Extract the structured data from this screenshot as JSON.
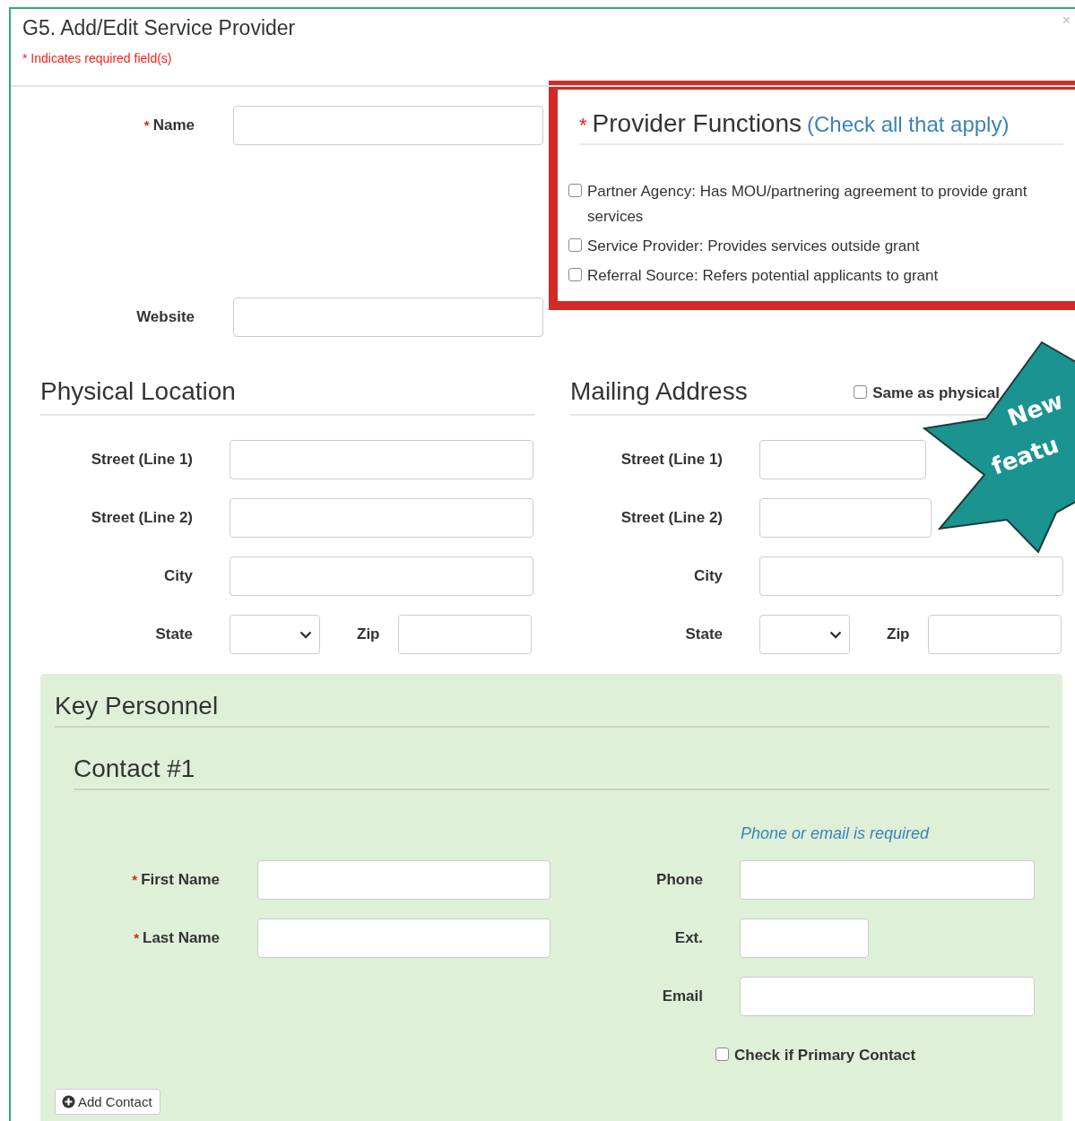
{
  "dialog": {
    "title": "G5. Add/Edit Service Provider",
    "close": "×",
    "required_note": "* Indicates required field(s)"
  },
  "fields": [
    {
      "label": "Name",
      "required_mark": "*"
    },
    {
      "label": "Website"
    }
  ],
  "provider_functions": {
    "required_mark": "*",
    "title": "Provider Functions",
    "hint": "(Check all that apply)",
    "options": [
      {
        "label": "Partner Agency: Has MOU/partnering agreement to provide grant services",
        "checked": false
      },
      {
        "label": "Service Provider: Provides services outside grant",
        "checked": false
      },
      {
        "label": "Referral Source: Refers potential applicants to grant",
        "checked": false
      }
    ]
  },
  "physical_location": {
    "title": "Physical Location",
    "fields": [
      {
        "kind": "text",
        "label": "Street (Line 1)"
      },
      {
        "kind": "text",
        "label": "Street (Line 2)"
      },
      {
        "kind": "text",
        "label": "City"
      },
      {
        "kind": "state_zip",
        "label": "State",
        "zip_label": "Zip"
      }
    ]
  },
  "mailing_address": {
    "title": "Mailing Address",
    "same_as": {
      "label": "Same as physical",
      "checked": false
    },
    "fields": [
      {
        "kind": "text",
        "label": "Street (Line 1)"
      },
      {
        "kind": "text",
        "label": "Street (Line 2)"
      },
      {
        "kind": "text",
        "label": "City"
      },
      {
        "kind": "state_zip",
        "label": "State",
        "zip_label": "Zip"
      }
    ]
  },
  "key_personnel": {
    "title": "Key Personnel",
    "contacts": [
      {
        "title": "Contact #1",
        "note": "Phone or email is required",
        "left_fields": [
          {
            "label": "First Name",
            "required_mark": "*"
          },
          {
            "label": "Last Name",
            "required_mark": "*"
          }
        ],
        "right_fields": [
          {
            "kind": "text",
            "label": "Phone"
          },
          {
            "kind": "short_text",
            "label": "Ext."
          },
          {
            "kind": "text",
            "label": "Email"
          }
        ],
        "primary": {
          "label": "Check if Primary Contact",
          "checked": false
        }
      }
    ],
    "add_button": "Add Contact"
  },
  "badge": {
    "lines": [
      "New",
      "featu"
    ]
  }
}
